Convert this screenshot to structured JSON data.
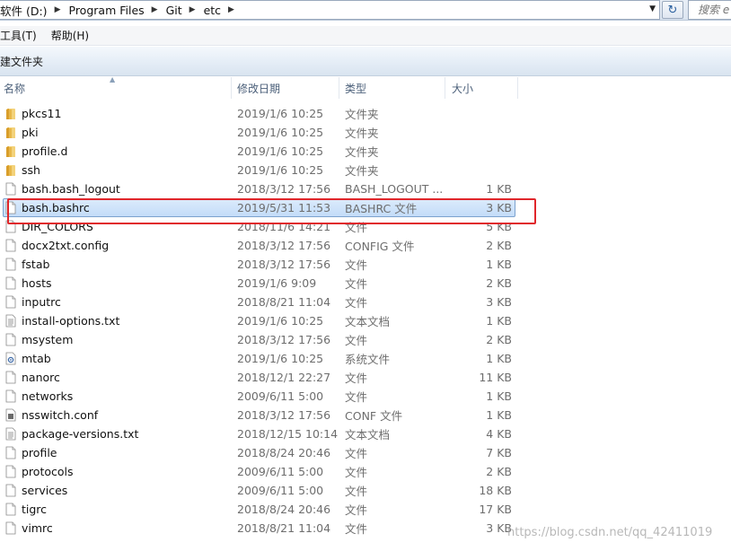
{
  "address": {
    "crumbs": [
      "软件 (D:)",
      "Program Files",
      "Git",
      "etc"
    ],
    "search_placeholder": "搜索 e"
  },
  "menu": [
    "工具(T)",
    "帮助(H)"
  ],
  "toolbar": {
    "new_folder": "建文件夹"
  },
  "columns": {
    "name": "名称",
    "date": "修改日期",
    "type": "类型",
    "size": "大小"
  },
  "rows": [
    {
      "name": "pkcs11",
      "date": "2019/1/6 10:25",
      "type": "文件夹",
      "size": "",
      "icon": "folder-icon"
    },
    {
      "name": "pki",
      "date": "2019/1/6 10:25",
      "type": "文件夹",
      "size": "",
      "icon": "folder-icon"
    },
    {
      "name": "profile.d",
      "date": "2019/1/6 10:25",
      "type": "文件夹",
      "size": "",
      "icon": "folder-icon"
    },
    {
      "name": "ssh",
      "date": "2019/1/6 10:25",
      "type": "文件夹",
      "size": "",
      "icon": "folder-icon"
    },
    {
      "name": "bash.bash_logout",
      "date": "2018/3/12 17:56",
      "type": "BASH_LOGOUT ...",
      "size": "1 KB",
      "icon": "file-icon"
    },
    {
      "name": "bash.bashrc",
      "date": "2019/5/31 11:53",
      "type": "BASHRC 文件",
      "size": "3 KB",
      "icon": "file-icon",
      "selected": true
    },
    {
      "name": "DIR_COLORS",
      "date": "2018/11/6 14:21",
      "type": "文件",
      "size": "5 KB",
      "icon": "file-icon"
    },
    {
      "name": "docx2txt.config",
      "date": "2018/3/12 17:56",
      "type": "CONFIG 文件",
      "size": "2 KB",
      "icon": "file-icon"
    },
    {
      "name": "fstab",
      "date": "2018/3/12 17:56",
      "type": "文件",
      "size": "1 KB",
      "icon": "file-icon"
    },
    {
      "name": "hosts",
      "date": "2019/1/6 9:09",
      "type": "文件",
      "size": "2 KB",
      "icon": "file-icon"
    },
    {
      "name": "inputrc",
      "date": "2018/8/21 11:04",
      "type": "文件",
      "size": "3 KB",
      "icon": "file-icon"
    },
    {
      "name": "install-options.txt",
      "date": "2019/1/6 10:25",
      "type": "文本文档",
      "size": "1 KB",
      "icon": "text-file-icon"
    },
    {
      "name": "msystem",
      "date": "2018/3/12 17:56",
      "type": "文件",
      "size": "2 KB",
      "icon": "file-icon"
    },
    {
      "name": "mtab",
      "date": "2019/1/6 10:25",
      "type": "系统文件",
      "size": "1 KB",
      "icon": "system-file-icon"
    },
    {
      "name": "nanorc",
      "date": "2018/12/1 22:27",
      "type": "文件",
      "size": "11 KB",
      "icon": "file-icon"
    },
    {
      "name": "networks",
      "date": "2009/6/11 5:00",
      "type": "文件",
      "size": "1 KB",
      "icon": "file-icon"
    },
    {
      "name": "nsswitch.conf",
      "date": "2018/3/12 17:56",
      "type": "CONF 文件",
      "size": "1 KB",
      "icon": "conf-file-icon"
    },
    {
      "name": "package-versions.txt",
      "date": "2018/12/15 10:14",
      "type": "文本文档",
      "size": "4 KB",
      "icon": "text-file-icon"
    },
    {
      "name": "profile",
      "date": "2018/8/24 20:46",
      "type": "文件",
      "size": "7 KB",
      "icon": "file-icon"
    },
    {
      "name": "protocols",
      "date": "2009/6/11 5:00",
      "type": "文件",
      "size": "2 KB",
      "icon": "file-icon"
    },
    {
      "name": "services",
      "date": "2009/6/11 5:00",
      "type": "文件",
      "size": "18 KB",
      "icon": "file-icon"
    },
    {
      "name": "tigrc",
      "date": "2018/8/24 20:46",
      "type": "文件",
      "size": "17 KB",
      "icon": "file-icon"
    },
    {
      "name": "vimrc",
      "date": "2018/8/21 11:04",
      "type": "文件",
      "size": "3 KB",
      "icon": "file-icon"
    }
  ],
  "watermark": "https://blog.csdn.net/qq_42411019",
  "colors": {
    "selection_border": "#7da2ce",
    "annotation_red": "#e0262b",
    "folder": "#e8b84a"
  }
}
